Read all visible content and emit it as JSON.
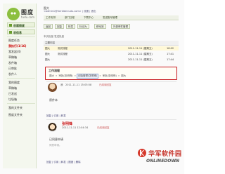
{
  "brand": {
    "name": "图度",
    "domain": "tudu.com"
  },
  "sidebar": {
    "compose_button": "创建图度",
    "inbox_button": "收信息",
    "items": [
      "图度任务",
      "我执行(1/16)",
      "我发起(4)",
      "草稿箱",
      "发件箱",
      "已审批",
      "发件人",
      "我的图度",
      "草稿箱",
      "已发送",
      "垃圾箱",
      "我的文件夹",
      "图度文件夹"
    ],
    "active_index": 1
  },
  "header": {
    "user_name": "图大",
    "user_links": "<admin1@tieridee.tudu.com> | 设置 | 退出",
    "tabs": [
      "工作安排",
      "部门日程",
      "下载中心",
      "发送账号管理"
    ]
  },
  "toolbar": {
    "buttons": [
      "返回",
      "回复",
      "转发",
      "标记为",
      "移动到",
      "外部邮件管理"
    ]
  },
  "list": {
    "header": "本页批量 发送批量",
    "column_title": "主题内容",
    "rows": [
      {
        "tag": "图大",
        "subject": "测试流程",
        "date": "2011-11-11 (星期五)",
        "time": "18:02"
      },
      {
        "tag": "图大",
        "subject": "测试流程",
        "date": "2011-11-11 (星期五)",
        "time": "17:41"
      },
      {
        "tag": "图大",
        "subject": "",
        "date": "2011-11-11 (星期五)",
        "time": "17:44"
      }
    ]
  },
  "workflow": {
    "title": "工作流程",
    "steps": [
      "图大",
      "审批(张明锋)",
      "创始管理(张明锋)",
      "审批(张明锋)",
      "图大"
    ],
    "current_index": 2
  },
  "messages": [
    {
      "sender": "我",
      "time": "2011-11-11 15:05:58",
      "note": "已阅读回复",
      "body": "原件本",
      "actions": "回复 | 引用 | 转发"
    },
    {
      "sender": "张明锋",
      "time": "2011-11-11 12:04:34",
      "note": "已阅读回复",
      "body": "已同意申请",
      "sig_line": "同意申请。",
      "actions": "回复 | 引用 | 转发 | 图度 | 删除"
    }
  ],
  "watermark": {
    "cn": "华军软件园",
    "en": "ONLINEDOWN",
    "suffix": ".net"
  }
}
